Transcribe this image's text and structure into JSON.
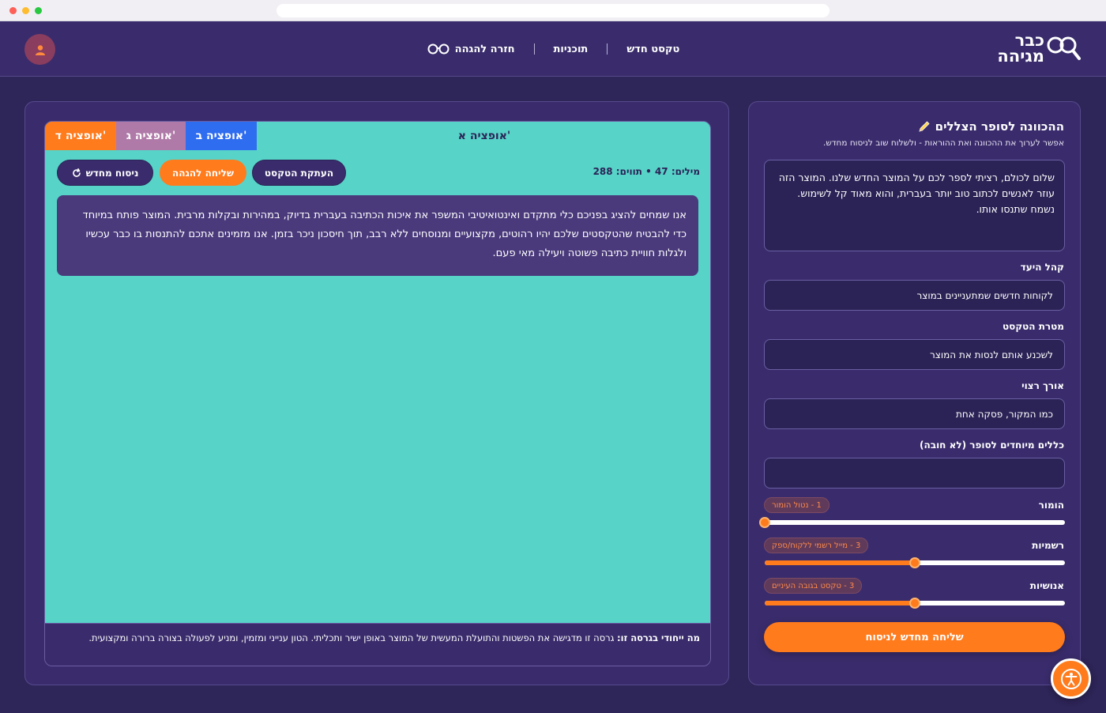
{
  "header": {
    "logo_line1": "כבר",
    "logo_line2": "מגיהה",
    "logo_icon": "magnifier-glasses-icon",
    "nav": [
      {
        "label": "טקסט חדש"
      },
      {
        "label": "תוכניות"
      },
      {
        "label": "חזרה להגהה",
        "icon": "glasses-icon"
      }
    ],
    "avatar_icon": "user-icon"
  },
  "brief_panel": {
    "title": "ההכוונה לסופר הצללים",
    "title_icon": "pencil-icon",
    "subtitle": "אפשר לערוך את ההכוונה ואת ההוראות - ולשלוח שוב לניסוח מחדש.",
    "message": "שלום לכולם, רציתי לספר לכם על המוצר החדש שלנו. המוצר הזה עוזר לאנשים לכתוב טוב יותר בעברית, והוא מאוד קל לשימוש. נשמח שתנסו אותו.",
    "fields": [
      {
        "label": "קהל היעד",
        "value": "לקוחות חדשים שמתעניינים במוצר"
      },
      {
        "label": "מטרת הטקסט",
        "value": "לשכנע אותם לנסות את המוצר"
      },
      {
        "label": "אורך רצוי",
        "value": "כמו המקור, פסקה אחת"
      },
      {
        "label": "כללים מיוחדים לסופר (לא חובה)",
        "value": ""
      }
    ],
    "sliders": [
      {
        "label": "הומור",
        "badge": "1 - נטול הומור",
        "value": 1,
        "max": 5
      },
      {
        "label": "רשמיות",
        "badge": "3 - מייל רשמי ללקוח/ספק",
        "value": 3,
        "max": 5
      },
      {
        "label": "אנושיות",
        "badge": "3 - טקסט בגובה העיניים",
        "value": 3,
        "max": 5
      }
    ],
    "resend_label": "שליחה מחדש לניסוח"
  },
  "result_panel": {
    "tabs": [
      {
        "label": "אופציה א'",
        "active": true,
        "color": "#57d3c8"
      },
      {
        "label": "אופציה ב'",
        "active": false,
        "color": "#2e6cf0"
      },
      {
        "label": "אופציה ג'",
        "active": false,
        "color": "#b07aa8"
      },
      {
        "label": "אופציה ד'",
        "active": false,
        "color": "#ff7b1c"
      }
    ],
    "stats": "מילים: 47 • תווים: 288",
    "buttons": {
      "copy": "העתקת הטקסט",
      "send": "שליחה להגהה",
      "retry": "ניסוח מחדש",
      "retry_icon": "refresh-icon"
    },
    "generated_text": "אנו שמחים להציג בפניכם כלי מתקדם ואינטואיטיבי המשפר את איכות הכתיבה בעברית בדיוק, במהירות ובקלות מרבית. המוצר פותח במיוחד כדי להבטיח שהטקסטים שלכם יהיו רהוטים, מקצועיים ומנוסחים ללא רבב, תוך חיסכון ניכר בזמן. אנו מזמינים אתכם להתנסות בו כבר עכשיו ולגלות חוויית כתיבה פשוטה ויעילה מאי פעם.",
    "note_label": "מה ייחודי בגרסה זו:",
    "note_text": "גרסה זו מדגישה את הפשטות והתועלת המעשית של המוצר באופן ישיר ותכליתי. הטון ענייני ומזמין, ומניע לפעולה בצורה ברורה ומקצועית."
  },
  "accessibility_icon": "accessibility-icon",
  "colors": {
    "background": "#2e2558",
    "panel": "#3a2c6c",
    "accent": "#ff7b1c",
    "teal": "#57d3c8",
    "blue": "#2e6cf0",
    "mauve": "#b07aa8"
  }
}
